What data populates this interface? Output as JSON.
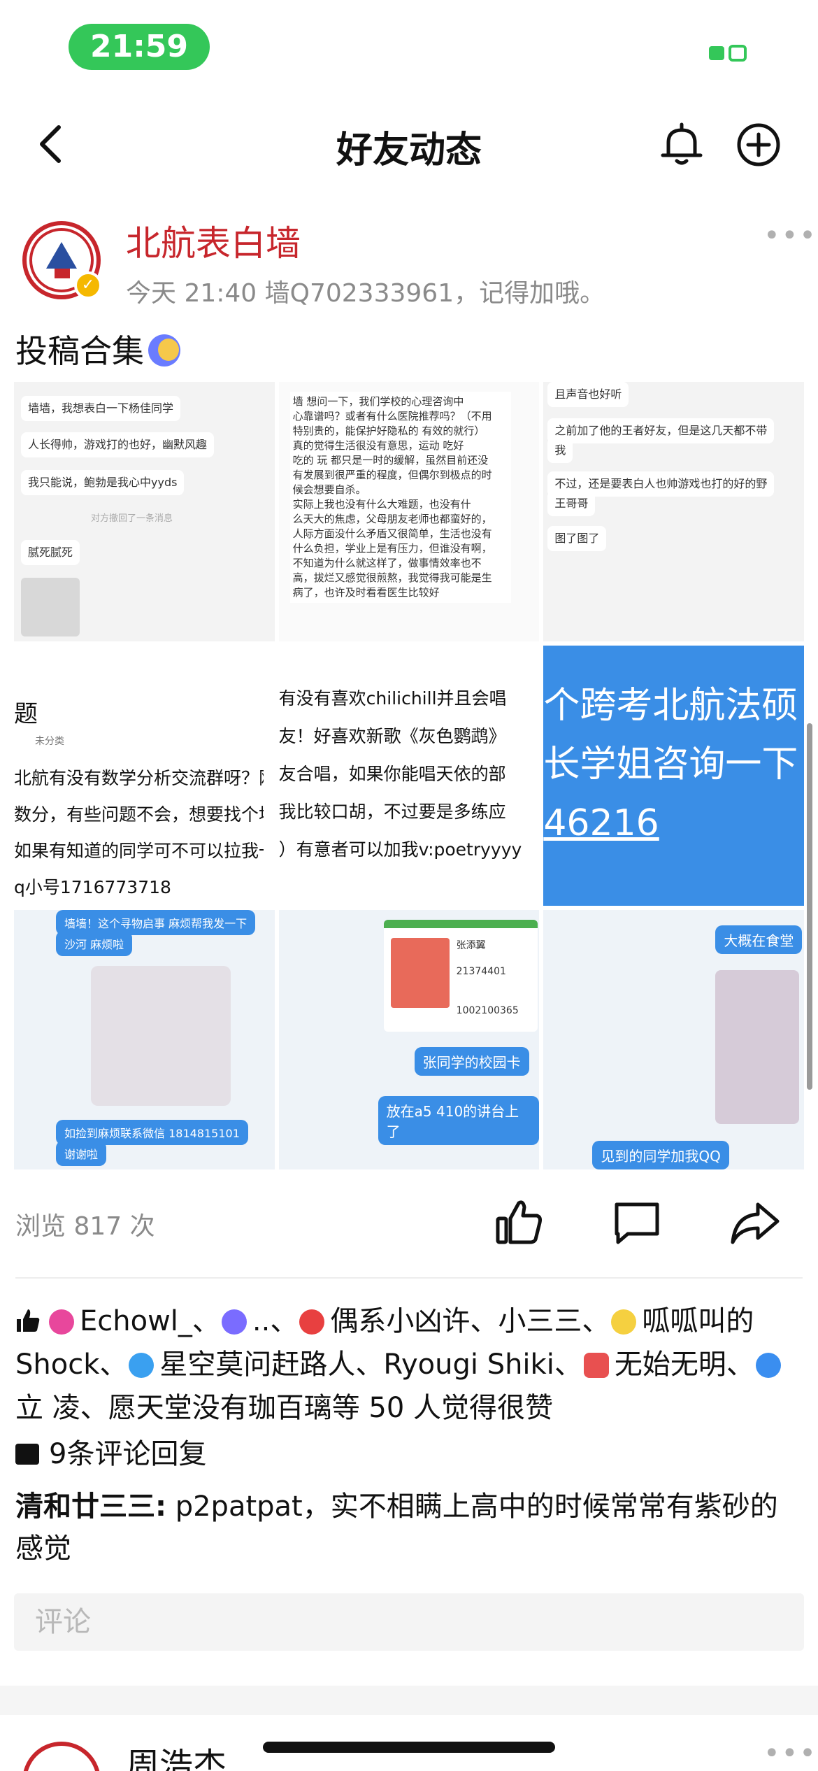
{
  "status_bar": {
    "time": "21:59"
  },
  "nav": {
    "title": "好友动态"
  },
  "post": {
    "author": "北航表白墙",
    "meta": "今天 21:40  墙Q702333961，记得加哦。",
    "text": "投稿合集",
    "views": "浏览 817 次",
    "images": [
      {
        "lines": [
          "墙墙，我想表白一下杨佳同学",
          "人长得帅，游戏打的也好，幽默风趣",
          "我只能说，鲍勃是我心中yyds",
          "对方撤回了一条消息",
          "腻死腻死"
        ]
      },
      {
        "lines": [
          "墙 想问一下，我们学校的心理咨询中",
          "心靠谱吗？或者有什么医院推荐吗？（不用",
          "特别贵的，能保护好隐私的 有效的就行）",
          "真的觉得生活很没有意思，运动 吃好",
          "吃的 玩 都只是一时的缓解，虽然目前还没",
          "有发展到很严重的程度，但偶尔到极点的时",
          "候会想要自杀。",
          "实际上我也没有什么大难题，也没有什",
          "么天大的焦虑，父母朋友老师也都蛮好的，",
          "人际方面没什么矛盾又很简单，生活也没有",
          "什么负担，学业上是有压力，但谁没有啊，",
          "不知道为什么就这样了，做事情效率也不",
          "高，拔烂又感觉很煎熬，我觉得我可能是生",
          "病了，也许及时看看医生比较好"
        ]
      },
      {
        "lines": [
          "且声音也好听",
          "之前加了他的王者好友，但是这几天都不带",
          "我",
          "不过，还是要表白人也帅游戏也打的好的野",
          "王哥哥",
          "图了图了"
        ]
      },
      {
        "lines": [
          "题",
          "未分类",
          "北航有没有数学分析交流群呀？刚",
          "数分，有些问题不会，想要找个地",
          "如果有知道的同学可不可以拉我一",
          "q小号1716773718"
        ]
      },
      {
        "lines": [
          "有没有喜欢chilichill并且会唱",
          "友！好喜欢新歌《灰色鹦鹉》",
          "友合唱，如果你能唱天依的部",
          "我比较口胡，不过要是多练应",
          "）有意者可以加我v:poetryyyy"
        ]
      },
      {
        "lines": [
          "个跨考北航法硕",
          "长学姐咨询一下",
          "46216"
        ]
      },
      {
        "lines": [
          "墙墙！这个寻物启事 麻烦帮我发一下",
          "沙河 麻烦啦",
          "如捡到麻烦联系微信 1814815101",
          "谢谢啦"
        ]
      },
      {
        "lines": [
          "张添翼",
          "21374401",
          "1002100365",
          "张同学的校园卡",
          "放在a5 410的讲台上了"
        ]
      },
      {
        "lines": [
          "大概在食堂",
          "见到的同学加我QQ"
        ]
      }
    ],
    "likes": {
      "names": [
        "Echowl_、",
        "..、",
        "偶系小凶许、小三三、",
        "呱呱叫的Shock、",
        "星空莫问赶路人、Ryougi Shiki、",
        "无始无明、",
        "立  凌、愿天堂没有珈百璃等 50 人觉得很赞"
      ],
      "colors": [
        "#e8479c",
        "#7a6cff",
        "#e84040",
        "#f5d040",
        "#3aa0f0",
        "#e85050",
        "#3a8ef0"
      ]
    },
    "comments_count": "9条评论回复",
    "comment": {
      "author": "清和廿三三:",
      "text": " p2patpat，实不相瞒上高中的时候常常有紫砂的感觉"
    },
    "comment_placeholder": "评论"
  },
  "next_post": {
    "author": "周浩杰"
  },
  "colors": {
    "accent_red": "#c7262c",
    "status_green": "#34c759",
    "link_blue": "#3a8ee6"
  },
  "icons": [
    "back-icon",
    "bell-icon",
    "plus-circle-icon",
    "more-icon",
    "thumbs-up-icon",
    "comment-icon",
    "share-icon"
  ]
}
